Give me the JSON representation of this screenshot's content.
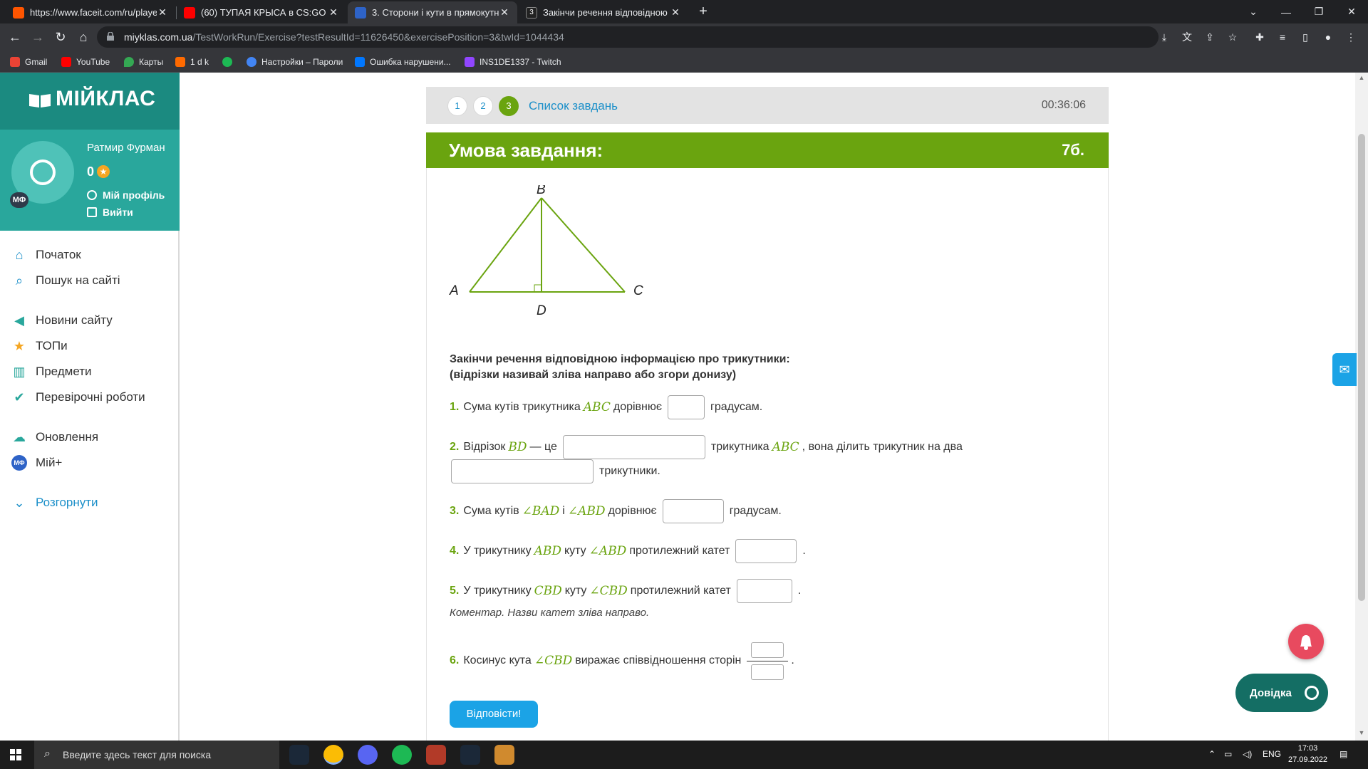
{
  "browser": {
    "tabs": [
      {
        "title": "https://www.faceit.com/ru/player",
        "color": "#ff5500"
      },
      {
        "title": "(60) ТУПАЯ КРЫСА в CS:GO - Yo",
        "color": "#ff0000"
      },
      {
        "title": "3. Сторони і кути в прямокутно",
        "color": "#2e63c7"
      },
      {
        "title": "Закінчи речення відповідною і",
        "color": "#222222"
      }
    ],
    "url_host": "miyklas.com.ua",
    "url_path": "/TestWorkRun/Exercise?testResultId=11626450&exercisePosition=3&twId=1044434",
    "bookmarks": [
      "Gmail",
      "YouTube",
      "Карты",
      "1 d k",
      "",
      "Настройки – Пароли",
      "Ошибка нарушени...",
      "INS1DE1337 - Twitch"
    ]
  },
  "sidebar": {
    "logo": "МІЙКЛАС",
    "user_name": "Ратмир Фурман",
    "points": "0",
    "avatar_badge": "МФ",
    "profile_link": "Мій профіль",
    "logout_link": "Вийти",
    "menu": [
      {
        "label": "Початок",
        "icon": "home-icon"
      },
      {
        "label": "Пошук на сайті",
        "icon": "search-icon"
      },
      {
        "label": "Новини сайту",
        "icon": "megaphone-icon"
      },
      {
        "label": "ТОПи",
        "icon": "star-icon"
      },
      {
        "label": "Предмети",
        "icon": "book-icon"
      },
      {
        "label": "Перевірочні роботи",
        "icon": "check-circle-icon"
      },
      {
        "label": "Оновлення",
        "icon": "cloud-icon"
      },
      {
        "label": "Мій+",
        "icon": "my-plus-icon"
      }
    ],
    "expand_label": "Розгорнути"
  },
  "task": {
    "pages": [
      "1",
      "2",
      "3"
    ],
    "current_page": "3",
    "task_list_label": "Список завдань",
    "timer": "00:36:06",
    "header": "Умова завдання:",
    "points": "7б.",
    "figure_labels": {
      "a": "A",
      "b": "B",
      "c": "C",
      "d": "D"
    },
    "instruction_line1": "Закінчи речення відповідною інформацією про трикутники:",
    "instruction_line2": "(відрізки називай зліва направо  або згори донизу)",
    "questions": {
      "q1": {
        "num": "1.",
        "t1": "Сума кутів трикутника",
        "m1": "ABC",
        "t2": "дорівнює",
        "t3": "градусам."
      },
      "q2": {
        "num": "2.",
        "t1": "Відрізок",
        "m1": "BD",
        "t2": "— це",
        "t3": "трикутника",
        "m2": "ABC",
        "t4": ", вона ділить трикутник на два",
        "t5": "трикутники."
      },
      "q3": {
        "num": "3.",
        "t1": "Сума кутів",
        "m1": "∠BAD",
        "t2": "і",
        "m2": "∠ABD",
        "t3": "дорівнює",
        "t4": "градусам."
      },
      "q4": {
        "num": "4.",
        "t1": "У трикутнику",
        "m1": "ABD",
        "t2": "куту",
        "m2": "∠ABD",
        "t3": "протилежний катет",
        "t4": "."
      },
      "q5": {
        "num": "5.",
        "t1": "У трикутнику",
        "m1": "CBD",
        "t2": "куту",
        "m2": "∠CBD",
        "t3": "протилежний катет",
        "t4": "."
      },
      "q6": {
        "num": "6.",
        "t1": "Косинус кута",
        "m1": "∠CBD",
        "t2": "виражає співвідношення сторін",
        "t3": "."
      }
    },
    "comment": "Коментар. Назви катет зліва направо.",
    "submit_label": "Відповісти!"
  },
  "widgets": {
    "help_label": "Довідка"
  },
  "taskbar": {
    "search_placeholder": "Введите здесь текст для поиска",
    "lang": "ENG",
    "time": "17:03",
    "date": "27.09.2022"
  }
}
